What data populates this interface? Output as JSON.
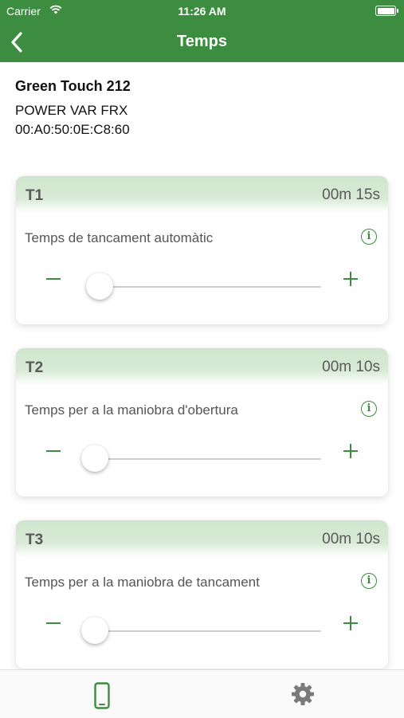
{
  "status_bar": {
    "carrier": "Carrier",
    "time": "11:26 AM"
  },
  "nav": {
    "title": "Temps",
    "back_icon": "chevron-left-icon"
  },
  "device": {
    "name": "Green Touch 212",
    "model": "POWER VAR FRX",
    "mac": "00:A0:50:0E:C8:60"
  },
  "timers": [
    {
      "id": "T1",
      "value": "00m 15s",
      "description": "Temps de tancament automàtic",
      "slider_fraction": 0.05
    },
    {
      "id": "T2",
      "value": "00m 10s",
      "description": "Temps per a la maniobra d'obertura",
      "slider_fraction": 0.03
    },
    {
      "id": "T3",
      "value": "00m 10s",
      "description": "Temps per a la maniobra de tancament",
      "slider_fraction": 0.03
    }
  ],
  "tab_bar": {
    "items": [
      {
        "icon": "phone-icon",
        "active": true
      },
      {
        "icon": "gear-icon",
        "active": false
      }
    ]
  },
  "colors": {
    "accent": "#3c8d3f",
    "header_tint": "#d4e8d2",
    "inactive_icon": "#7a7a7a"
  }
}
